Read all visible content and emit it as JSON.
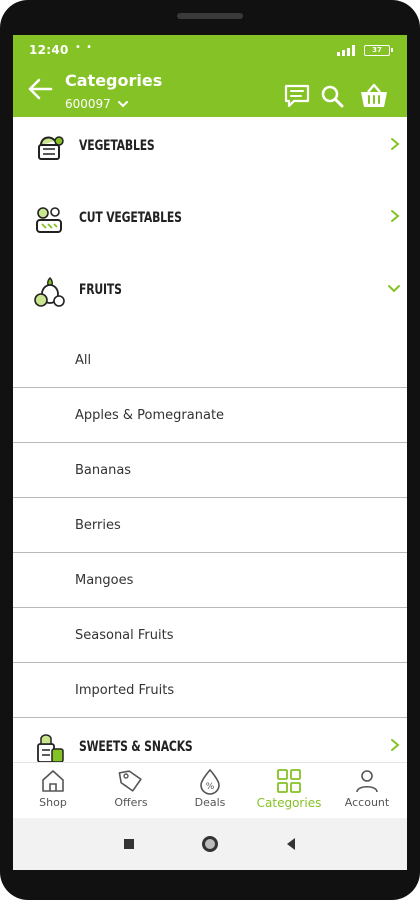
{
  "status": {
    "time": "12:40",
    "dots": "• •",
    "battery": "37"
  },
  "header": {
    "title": "Categories",
    "pincode": "600097"
  },
  "categories_top": [
    {
      "label": "VEGETABLES"
    },
    {
      "label": "CUT VEGETABLES"
    },
    {
      "label": "FRUITS"
    }
  ],
  "fruits_subcategories": [
    {
      "label": "All"
    },
    {
      "label": "Apples & Pomegranate"
    },
    {
      "label": "Bananas"
    },
    {
      "label": "Berries"
    },
    {
      "label": "Mangoes"
    },
    {
      "label": "Seasonal Fruits"
    },
    {
      "label": "Imported Fruits"
    }
  ],
  "categories_bottom": [
    {
      "label": "SWEETS & SNACKS"
    }
  ],
  "bottom_nav": [
    {
      "label": "Shop",
      "icon": "home-icon",
      "active": false
    },
    {
      "label": "Offers",
      "icon": "tag-icon",
      "active": false
    },
    {
      "label": "Deals",
      "icon": "percent-drop-icon",
      "active": false
    },
    {
      "label": "Categories",
      "icon": "grid-icon",
      "active": true
    },
    {
      "label": "Account",
      "icon": "user-icon",
      "active": false
    }
  ],
  "colors": {
    "brand": "#84c225",
    "text": "#222222",
    "divider": "#b9b9b9"
  }
}
